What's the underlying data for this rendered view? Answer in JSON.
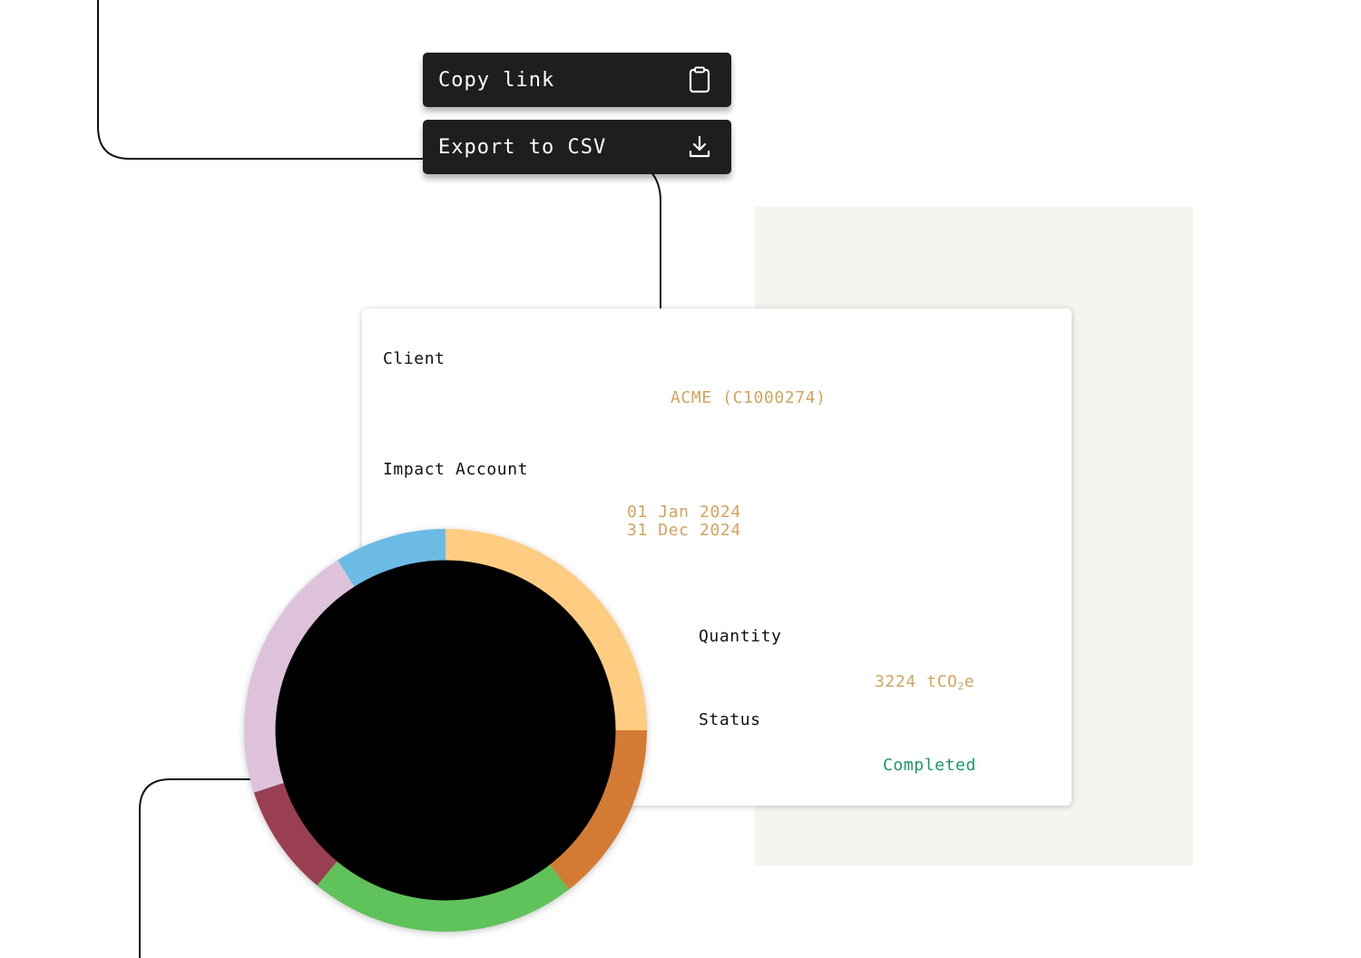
{
  "menu": {
    "copy_link": {
      "label": "Copy link",
      "icon": "clipboard-icon"
    },
    "export_csv": {
      "label": "Export to CSV",
      "icon": "download-icon"
    }
  },
  "details": {
    "client": {
      "label": "Client",
      "value": "ACME (C1000274)"
    },
    "impact_account": {
      "label": "Impact Account",
      "start_date": "01 Jan 2024",
      "end_date": "31 Dec 2024"
    },
    "quantity": {
      "label": "Quantity",
      "amount": "3224",
      "unit_prefix": "tCO",
      "unit_sub": "2",
      "unit_suffix": "e"
    },
    "status": {
      "label": "Status",
      "value": "Completed"
    }
  },
  "colors": {
    "value_text": "#d4a35e",
    "status_completed": "#169a5e",
    "menu_background": "#1e1e1e"
  },
  "donut": {
    "segments": [
      {
        "name": "light-orange",
        "color": "#fecd82",
        "fraction": 0.25
      },
      {
        "name": "dark-orange",
        "color": "#d37b34",
        "fraction": 0.145
      },
      {
        "name": "green",
        "color": "#5fc25a",
        "fraction": 0.215
      },
      {
        "name": "maroon",
        "color": "#9a3f52",
        "fraction": 0.09
      },
      {
        "name": "lilac",
        "color": "#dec2dc",
        "fraction": 0.21
      },
      {
        "name": "blue",
        "color": "#6cbbe5",
        "fraction": 0.09
      }
    ]
  }
}
